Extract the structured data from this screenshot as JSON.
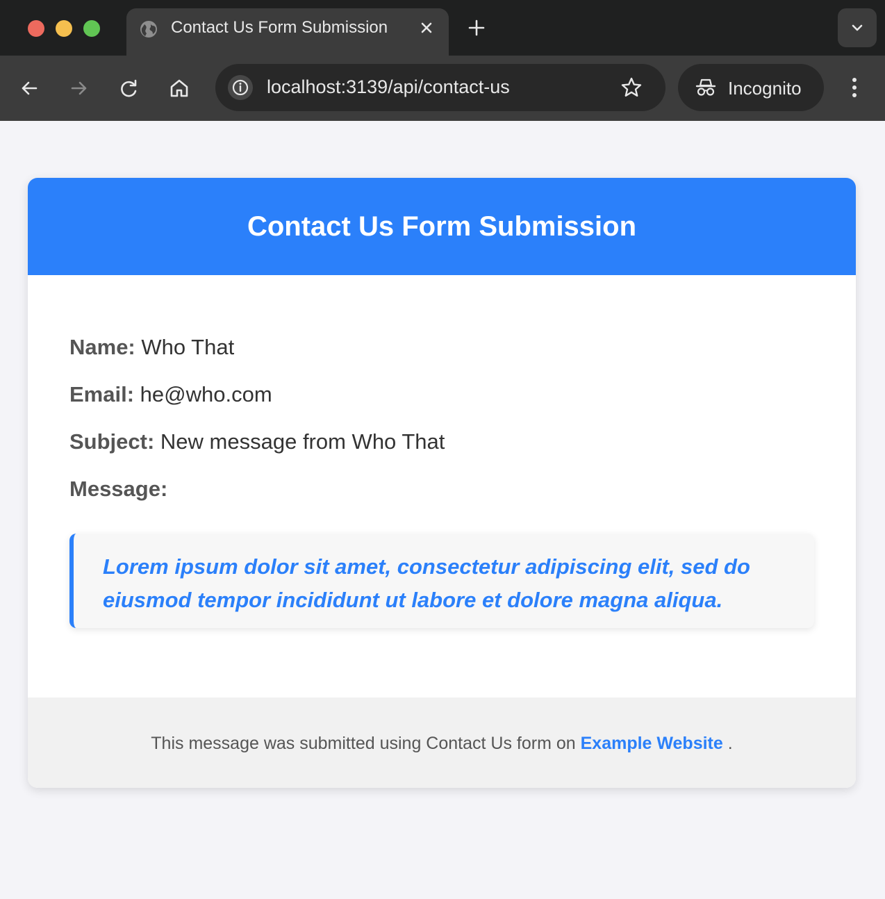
{
  "browser": {
    "tab_title": "Contact Us Form Submission",
    "url": "localhost:3139/api/contact-us",
    "profile_label": "Incognito",
    "icons": [
      "globe-icon",
      "close-icon",
      "plus-icon",
      "chevron-down-icon",
      "back-arrow-icon",
      "forward-arrow-icon",
      "reload-icon",
      "home-icon",
      "info-icon",
      "star-icon",
      "incognito-icon",
      "kebab-menu-icon"
    ]
  },
  "page": {
    "title": "Contact Us Form Submission",
    "fields": {
      "name_label": "Name:",
      "name_value": "Who That",
      "email_label": "Email:",
      "email_value": "he@who.com",
      "subject_label": "Subject:",
      "subject_value": "New message from Who That",
      "message_label": "Message:"
    },
    "message": "Lorem ipsum dolor sit amet, consectetur adipiscing elit, sed do eiusmod tempor incididunt ut labore et dolore magna aliqua.",
    "footer": {
      "text_before": "This message was submitted using Contact Us form on",
      "link_text": "Example Website",
      "text_after": "."
    }
  },
  "colors": {
    "accent": "#2b80fa",
    "page_bg": "#f4f4f8",
    "chrome_dark": "#1f2020",
    "chrome_toolbar": "#3c3c3c"
  }
}
